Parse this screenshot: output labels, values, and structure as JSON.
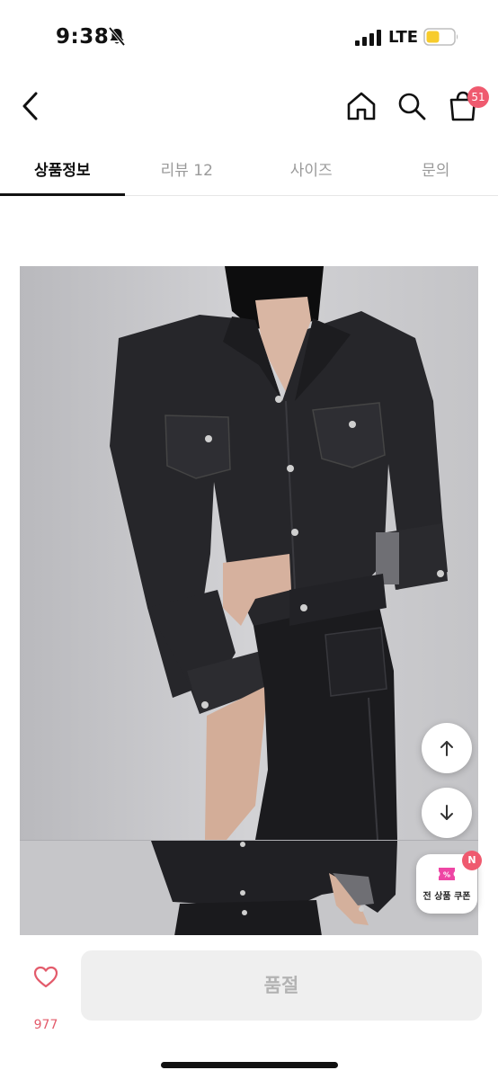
{
  "status": {
    "time": "9:38",
    "network": "LTE",
    "battery_color": "#f7cc2c",
    "icons": [
      "bell-slash-icon",
      "signal-bars-icon",
      "battery-icon"
    ]
  },
  "nav": {
    "icons": [
      "back-chevron-icon",
      "home-icon",
      "search-icon",
      "shopping-bag-icon"
    ],
    "cart_count": "51",
    "badge_color": "#ef5a6f"
  },
  "tabs": [
    {
      "label": "상품정보",
      "active": true
    },
    {
      "label": "리뷰 12",
      "active": false
    },
    {
      "label": "사이즈",
      "active": false
    },
    {
      "label": "문의",
      "active": false
    }
  ],
  "floating": {
    "icons": [
      "arrow-up-icon",
      "arrow-down-icon"
    ],
    "coupon_label": "전 상품 쿠폰",
    "coupon_badge": "N"
  },
  "bottom": {
    "like_count": "977",
    "soldout_label": "품절",
    "accent": "#e35b6b"
  }
}
